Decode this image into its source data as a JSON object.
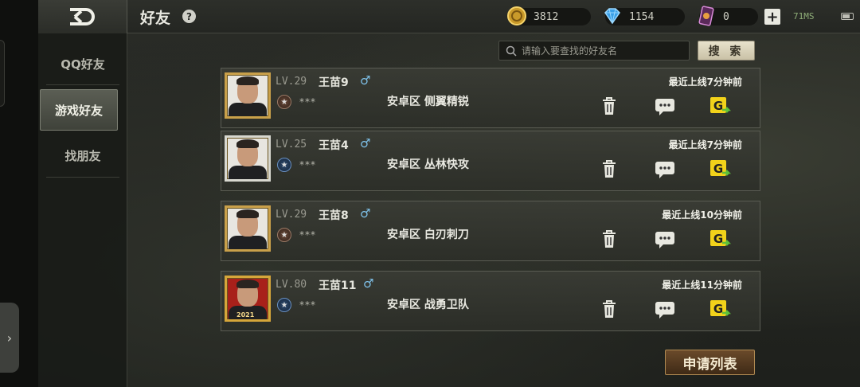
{
  "header": {
    "title": "好友",
    "help_label": "?",
    "gold": "3812",
    "diamonds": "1154",
    "cards": "0",
    "add_label": "+",
    "network": "71MS"
  },
  "sidebar": {
    "items": [
      {
        "label": "QQ好友"
      },
      {
        "label": "游戏好友"
      },
      {
        "label": "找朋友"
      }
    ]
  },
  "search": {
    "placeholder": "请输入要查找的好友名",
    "button_label": "搜 索"
  },
  "friends": [
    {
      "level": "LV.29",
      "name": "王苗9",
      "gender": "♂",
      "clan": "***",
      "server": "安卓区  侧翼精锐",
      "last_online": "最近上线7分钟前"
    },
    {
      "level": "LV.25",
      "name": "王苗4",
      "gender": "♂",
      "clan": "***",
      "server": "安卓区  丛林快攻",
      "last_online": "最近上线7分钟前"
    },
    {
      "level": "LV.29",
      "name": "王苗8",
      "gender": "♂",
      "clan": "***",
      "server": "安卓区  白刃刺刀",
      "last_online": "最近上线10分钟前"
    },
    {
      "level": "LV.80",
      "name": "王苗11",
      "gender": "♂",
      "clan": "***",
      "server": "安卓区  战勇卫队",
      "last_online": "最近上线11分钟前",
      "badge": "2021"
    }
  ],
  "footer": {
    "apply_list_label": "申请列表"
  },
  "icons": {
    "back": "back-arrow-icon",
    "gold": "gold-coin-icon",
    "diamond": "diamond-icon",
    "card": "card-icon",
    "delete": "trash-icon",
    "chat": "chat-bubble-icon",
    "invite": "invite-game-icon"
  },
  "colors": {
    "gold_frame": "#c9a04a",
    "male_symbol": "#7ec0e8",
    "invite_yellow": "#f2d21a",
    "network_green": "#8fae78"
  }
}
